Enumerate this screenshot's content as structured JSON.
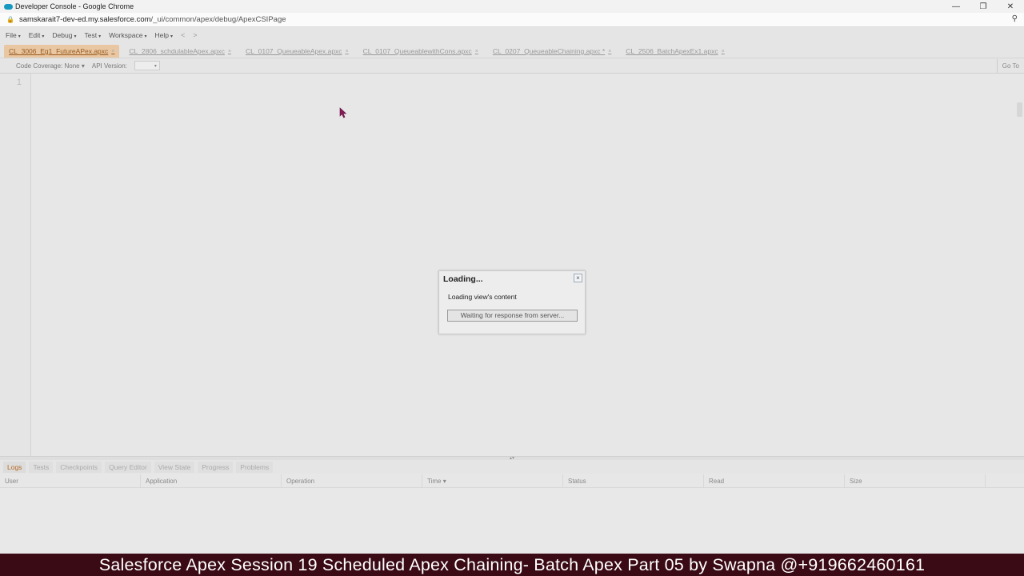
{
  "browser": {
    "window_title": "Developer Console - Google Chrome",
    "url_host": "samskarait7-dev-ed.my.salesforce.com",
    "url_path": "/_ui/common/apex/debug/ApexCSIPage",
    "controls": {
      "minimize": "—",
      "restore": "❐",
      "close": "✕"
    },
    "zoom_icon": "⚲"
  },
  "menu": {
    "items": [
      "File",
      "Edit",
      "Debug",
      "Test",
      "Workspace",
      "Help"
    ],
    "caret": "▾",
    "back": "<",
    "forward": ">"
  },
  "tabs": [
    {
      "label": "CL_3006_Eg1_FutureAPex.apxc",
      "active": true
    },
    {
      "label": "CL_2806_schdulableApex.apxc",
      "active": false
    },
    {
      "label": "CL_0107_QueueableApex.apxc",
      "active": false
    },
    {
      "label": "CL_0107_QueueablewithCons.apxc",
      "active": false
    },
    {
      "label": "CL_0207_QueueableChaining.apxc *",
      "active": false
    },
    {
      "label": "CL_2506_BatchApexEx1.apxc",
      "active": false
    }
  ],
  "tab_close": "×",
  "toolbar": {
    "code_coverage": "Code Coverage: None",
    "api_version": "API Version:",
    "goto": "Go To"
  },
  "editor": {
    "line_number": "1"
  },
  "dialog": {
    "title": "Loading...",
    "message": "Loading view's content",
    "progress": "Waiting for response from server...",
    "close": "×"
  },
  "bottom_tabs": [
    "Logs",
    "Tests",
    "Checkpoints",
    "Query Editor",
    "View State",
    "Progress",
    "Problems"
  ],
  "logs_columns": [
    "User",
    "Application",
    "Operation",
    "Time ▾",
    "Status",
    "Read",
    "Size"
  ],
  "caption": "Salesforce Apex Session 19 Scheduled Apex Chaining- Batch Apex Part 05 by Swapna @+919662460161",
  "colors": {
    "active_tab": "#e8c7a2",
    "caption_bg": "#3a0a15",
    "cursor": "#8b1a5a"
  }
}
